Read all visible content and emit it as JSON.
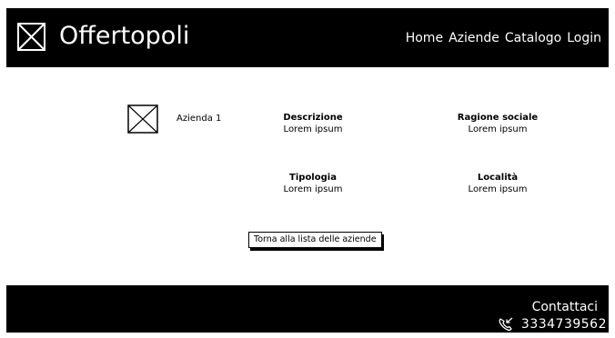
{
  "header": {
    "brand": "Offertopoli",
    "nav": [
      "Home",
      "Aziende",
      "Catalogo",
      "Login"
    ]
  },
  "company": {
    "name": "Azienda 1",
    "fields": {
      "descrizione": {
        "label": "Descrizione",
        "value": "Lorem ipsum"
      },
      "ragione_sociale": {
        "label": "Ragione sociale",
        "value": "Lorem ipsum"
      },
      "tipologia": {
        "label": "Tipologia",
        "value": "Lorem ipsum"
      },
      "localita": {
        "label": "Località",
        "value": "Lorem ipsum"
      }
    }
  },
  "actions": {
    "back_label": "Torna alla lista delle aziende"
  },
  "footer": {
    "contact_title": "Contattaci",
    "phone": "3334739562",
    "phone_icon": "phone-outgoing-icon"
  },
  "colors": {
    "bar_background": "#000000",
    "page_background": "#ffffff",
    "text_light": "#ffffff",
    "text_dark": "#000000"
  }
}
